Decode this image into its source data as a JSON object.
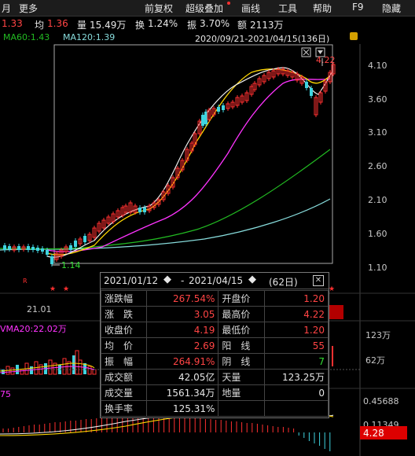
{
  "menubar": {
    "items": [
      "月",
      "更多",
      "前复权",
      "超级叠加",
      "画线",
      "工具",
      "帮助",
      "F9",
      "隐藏"
    ]
  },
  "quote": {
    "price_prefix": "1.33",
    "avg_label": "均",
    "avg_value": "1.36",
    "volume_label": "量",
    "volume_value": "15.49万",
    "turnover_label": "换",
    "turnover_value": "1.24%",
    "amplitude_label": "振",
    "amplitude_value": "3.70%",
    "amount_label": "额",
    "amount_value": "2113万"
  },
  "ma": {
    "ma60": "MA60:1.43",
    "ma120": "MA120:1.39",
    "range": "2020/09/21-2021/04/15(136日)"
  },
  "price_axis": [
    "4.10",
    "3.60",
    "3.10",
    "2.60",
    "2.10",
    "1.60",
    "1.10"
  ],
  "annotations": {
    "low_price": "1.14",
    "high_price": "4.22",
    "date_label": "21.01",
    "vma": "VMA20:22.02万",
    "volume_ticks": [
      "123万",
      "62万"
    ],
    "macd_ticks": [
      "0.45688",
      "0.11349"
    ],
    "current_price": "4.28",
    "left_fragment": "75"
  },
  "popup": {
    "start": "2021/01/12",
    "end": "2021/04/15",
    "days": "(62日)",
    "rows": [
      {
        "k1": "涨跌幅",
        "v1": "267.54%",
        "k2": "开盘价",
        "v2": "1.20"
      },
      {
        "k1": "涨　跌",
        "v1": "3.05",
        "k2": "最高价",
        "v2": "4.22"
      },
      {
        "k1": "收盘价",
        "v1": "4.19",
        "k2": "最低价",
        "v2": "1.20"
      },
      {
        "k1": "均　价",
        "v1": "2.69",
        "k2": "阳　线",
        "v2": "55"
      },
      {
        "k1": "振　幅",
        "v1": "264.91%",
        "k2": "阴　线",
        "v2": "7"
      },
      {
        "k1": "成交额",
        "v1": "42.05亿",
        "k2": "天量",
        "v2": "123.25万"
      },
      {
        "k1": "成交量",
        "v1": "1561.34万",
        "k2": "地量",
        "v2": "0"
      },
      {
        "k1": "换手率",
        "v1": "125.31%",
        "k2": "",
        "v2": ""
      }
    ]
  },
  "colors": {
    "up": "#ff3030",
    "down": "#3fd4e0",
    "ma5": "#ffffff",
    "ma10": "#ffd700",
    "ma20": "#ff33ff",
    "ma60": "#22bb22",
    "ma120": "#88dddd"
  }
}
